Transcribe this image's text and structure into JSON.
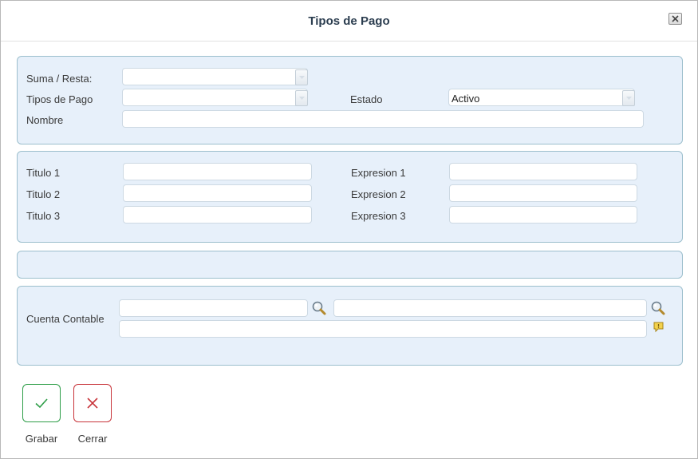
{
  "window": {
    "title": "Tipos de Pago"
  },
  "section_general": {
    "suma_resta_label": "Suma / Resta:",
    "suma_resta_value": "",
    "tipos_pago_label": "Tipos de Pago",
    "tipos_pago_value": "",
    "estado_label": "Estado",
    "estado_value": "Activo",
    "nombre_label": "Nombre",
    "nombre_value": ""
  },
  "section_titles": {
    "titulo1_label": "Titulo 1",
    "titulo2_label": "Titulo 2",
    "titulo3_label": "Titulo 3",
    "expresion1_label": "Expresion 1",
    "expresion2_label": "Expresion 2",
    "expresion3_label": "Expresion 3"
  },
  "section_account": {
    "cuenta_label": "Cuenta Contable"
  },
  "actions": {
    "save_label": "Grabar",
    "close_label": "Cerrar"
  },
  "colors": {
    "panel_bg": "#e7f0fa",
    "panel_border": "#9cbfcd",
    "save": "#2e9e48",
    "close": "#c8343a"
  },
  "icons": {
    "close": "close-icon",
    "dropdown": "chevron-down-icon",
    "search": "search-icon",
    "note": "note-icon",
    "save": "check-icon",
    "cancel": "x-icon"
  }
}
